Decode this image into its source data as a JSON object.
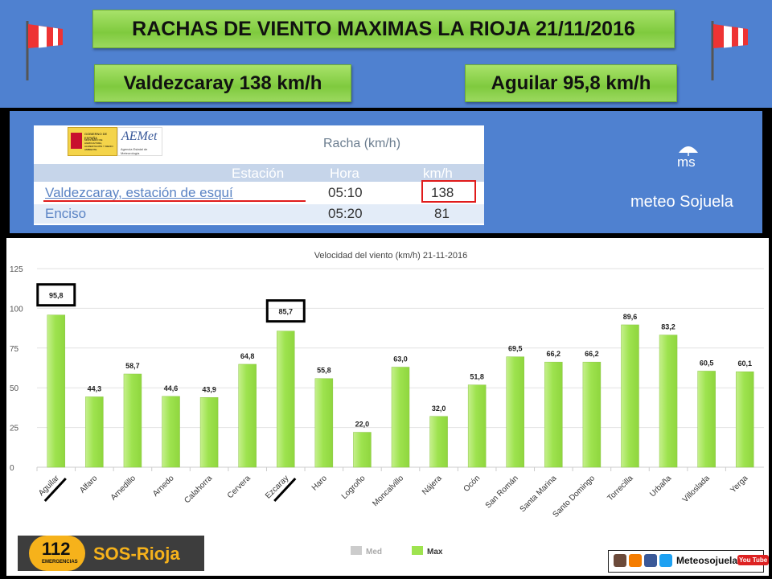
{
  "header": {
    "title": "RACHAS DE VIENTO MAXIMAS LA RIOJA 21/11/2016",
    "station_left": "Valdezcaray 138 km/h",
    "station_right": "Aguilar 95,8 km/h"
  },
  "aemet": {
    "logo_ministry": "GOBIERNO DE ESPAÑA",
    "logo_ministry_sub": "MINISTERIO DE AGRICULTURA, ALIMENTACIÓN Y MEDIO AMBIENTE",
    "logo_aemet": "AEMet",
    "logo_aemet_sub": "Agencia Estatal de Meteorología",
    "table_title": "Racha (km/h)",
    "columns": [
      "Estación",
      "Hora",
      "km/h"
    ],
    "rows": [
      {
        "station": "Valdezcaray, estación de esquí",
        "time": "05:10",
        "value": "138"
      },
      {
        "station": "Enciso",
        "time": "05:20",
        "value": "81"
      }
    ]
  },
  "meteo": {
    "ms_logo": "ms",
    "brand": "meteo Sojuela"
  },
  "colors": {
    "header_blue": "#4f81d0",
    "bar_green": "#9ee34f",
    "highlight_red": "#e01b1b"
  },
  "chart_data": {
    "type": "bar",
    "title": "Velocidad del viento (km/h) 21-11-2016",
    "categories": [
      "Aguilar",
      "Alfaro",
      "Arnedillo",
      "Arnedo",
      "Calahorra",
      "Cervera",
      "Ezcaray",
      "Haro",
      "Logroño",
      "Moncalvillo",
      "Nájera",
      "Ocón",
      "San Román",
      "Santa Marina",
      "Santo Domingo",
      "Torrecilla",
      "Urbaña",
      "Villoslada",
      "Yerga"
    ],
    "series": [
      {
        "name": "Med",
        "values": []
      },
      {
        "name": "Max",
        "values": [
          95.8,
          44.3,
          58.7,
          44.6,
          43.9,
          64.8,
          85.7,
          55.8,
          22.0,
          63.0,
          32.0,
          51.8,
          69.5,
          66.2,
          66.2,
          89.6,
          83.2,
          60.5,
          60.1
        ]
      }
    ],
    "value_labels": [
      "95,8",
      "44,3",
      "58,7",
      "44,6",
      "43,9",
      "64,8",
      "85,7",
      "55,8",
      "22,0",
      "63,0",
      "32,0",
      "51,8",
      "69,5",
      "66,2",
      "66,2",
      "89,6",
      "83,2",
      "60,5",
      "60,1"
    ],
    "yticks": [
      "0",
      "25",
      "50",
      "75",
      "100",
      "125"
    ],
    "ylim": [
      0,
      125
    ],
    "grid": true,
    "legend_position": "bottom-center",
    "legend_colors": {
      "Med": "#cccccc",
      "Max": "#9ee34f"
    },
    "boxed_categories": [
      "Aguilar",
      "Ezcaray"
    ]
  },
  "footer": {
    "sos_number": "112",
    "sos_sub": "EMERGENCIAS",
    "sos_label": "SOS-Rioja",
    "social_label": "Meteosojuela",
    "youtube_label": "You Tube"
  }
}
